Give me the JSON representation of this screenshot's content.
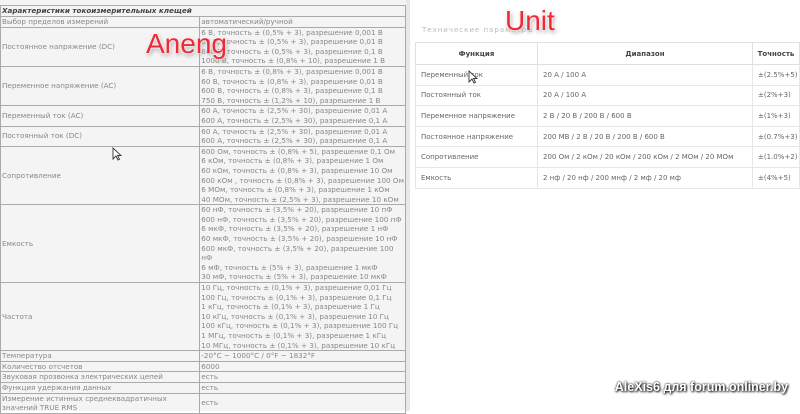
{
  "aneng": {
    "label": "Aneng",
    "caption": "Характеристики токоизмерительных клещей",
    "rows": [
      {
        "k": "Выбор пределов измерений",
        "v": [
          "автоматический/ручной"
        ]
      },
      {
        "k": "Постоянное напряжение (DC)",
        "v": [
          "6 В, точность ± (0,5% + 3), разрешение 0,001 В",
          "60 В, точность ± (0,5% + 3), разрешение 0,01 В",
          "600 В, точность ± (0,5% + 3), разрешение 0,1 В",
          "1000 В, точность ± (0,8% + 10), разрешение 1 В"
        ]
      },
      {
        "k": "Переменное напряжение (AC)",
        "v": [
          "6 В, точность ± (0,8% + 3), разрешение 0,001 В",
          "60 В, точность ± (0,8% + 3), разрешение 0,01 В",
          "600 В, точность ± (0,8% + 3), разрешение 0,1 В",
          "750 В, точность ± (1,2% + 10), разрешение 1 В"
        ]
      },
      {
        "k": "Переменный ток (AC)",
        "v": [
          "60 А, точность ± (2,5% + 30), разрешение 0,01 А",
          "600 А, точность ± (2,5% + 30), разрешение 0,1 А"
        ]
      },
      {
        "k": "Постоянный ток (DC)",
        "v": [
          "60 А, точность ± (2,5% + 30), разрешение 0,01 А",
          "600 А, точность ± (2,5% + 30), разрешение 0,1 А"
        ]
      },
      {
        "k": "Сопротивление",
        "v": [
          "600 Ом, точность ± (0,8% + 5), разрешение 0,1 Ом",
          "6 кОм, точность ± (0,8% + 3), разрешение 1 Ом",
          "60 кОм, точность ± (0,8% + 3), разрешение 10 Ом",
          "600 кОм , точность ± (0,8% + 3), разрешение 100 Ом",
          "6 МОм, точность ± (0,8% + 3), разрешение 1 кОм",
          "40 МОм, точность ± (2,5% + 3), разрешение 10 кОм"
        ]
      },
      {
        "k": "Емкость",
        "v": [
          "60 нФ, точность ± (3,5% + 20), разрешение 10 пФ",
          "600 нФ, точность ± (3,5% + 20), разрешение 100 пФ",
          "6 мкФ, точность ± (3,5% + 20), разрешение 1 нФ",
          "60 мкФ, точность ± (3,5% + 20), разрешение 10 нФ",
          "600 мкФ, точность ± (3,5% + 20), разрешение 100",
          "нФ",
          "6 мФ, точность ± (5% + 3), разрешение 1 мкФ",
          "30 мФ, точность ± (5% + 3), разрешение 10 мкФ"
        ]
      },
      {
        "k": "Частота",
        "v": [
          "10 Гц, точность ± (0,1% + 3), разрешение 0,01 Гц",
          "100 Гц, точность ± (0,1% + 3), разрешение 0,1 Гц",
          "1 кГц, точность ± (0,1% + 3), разрешение 1 Гц",
          "10 кГц, точность ± (0,1% + 3), разрешение 10 Гц",
          "100 кГц, точность ± (0,1% + 3), разрешение 100 Гц",
          "1 МГц, точность ± (0,1% + 3), разрешение 1 кГц",
          "10 МГц, точность ± (0,1% + 3), разрешение 10 кГц"
        ]
      },
      {
        "k": "Температура",
        "v": [
          "-20°C ~ 1000°C / 0°F ~ 1832°F"
        ]
      },
      {
        "k": "Количество отсчетов",
        "v": [
          "6000"
        ]
      },
      {
        "k": "Звуковая прозвонка электрических цепей",
        "v": [
          "есть"
        ]
      },
      {
        "k": "Функция удержания данных",
        "v": [
          "есть"
        ]
      },
      {
        "k": "Измерение истинных среднеквадратичных значений TRUE RMS",
        "v": [
          "есть"
        ]
      }
    ]
  },
  "unit": {
    "label": "Unit",
    "title": "Технические параметры",
    "headers": [
      "Функция",
      "Диапазон",
      "Точность"
    ],
    "rows": [
      [
        "Переменный ток",
        "20 А / 100 А",
        "±(2.5%+5)"
      ],
      [
        "Постоянный ток",
        "20 А / 100 А",
        "±(2%+3)"
      ],
      [
        "Переменное напряжение",
        "2 В / 20 В / 200 В / 600 В",
        "±(1%+3)"
      ],
      [
        "Постоянное напряжение",
        "200 МВ / 2 В / 20 В / 200 В / 600 В",
        "±(0.7%+3)"
      ],
      [
        "Сопротивление",
        "200 Ом / 2 кОм / 20 кОм / 200 кОм / 2 МОм / 20 МОм",
        "±(1.0%+2)"
      ],
      [
        "Емкость",
        "2 нф / 20 нф / 200 мнф / 2 мф / 20 мф",
        "±(4%+5)"
      ]
    ]
  },
  "watermark": "AleXis6 для forum.onliner.by"
}
